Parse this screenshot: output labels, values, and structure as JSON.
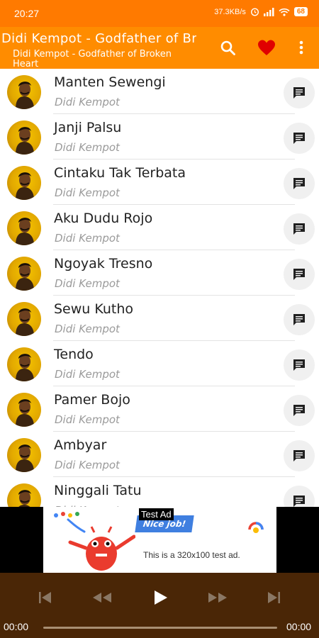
{
  "status_bar": {
    "time": "20:27",
    "network_speed": "37.3KB/s",
    "battery": "68"
  },
  "toolbar": {
    "title": "Didi Kempot - Godfather of Broken Heart",
    "subtitle": "Didi Kempot - Godfather of Broken Heart",
    "icons": [
      "search-icon",
      "heart-icon",
      "more-vert-icon"
    ],
    "accent_color": "#ff8c00"
  },
  "songs": [
    {
      "title": "Manten Sewengi",
      "artist": "Didi Kempot"
    },
    {
      "title": "Janji Palsu",
      "artist": "Didi Kempot"
    },
    {
      "title": "Cintaku Tak Terbata",
      "artist": "Didi Kempot"
    },
    {
      "title": "Aku Dudu Rojo",
      "artist": "Didi Kempot"
    },
    {
      "title": "Ngoyak Tresno",
      "artist": "Didi Kempot"
    },
    {
      "title": "Sewu Kutho",
      "artist": "Didi Kempot"
    },
    {
      "title": "Tendo",
      "artist": "Didi Kempot"
    },
    {
      "title": "Pamer Bojo",
      "artist": "Didi Kempot"
    },
    {
      "title": "Ambyar",
      "artist": "Didi Kempot"
    },
    {
      "title": "Ninggali Tatu",
      "artist": "Didi Kempot"
    }
  ],
  "ad": {
    "label": "Test Ad",
    "badge": "Nice job!",
    "text": "This is a 320x100 test ad."
  },
  "player": {
    "current_time": "00:00",
    "total_time": "00:00",
    "controls": [
      "skip-previous-icon",
      "rewind-icon",
      "play-icon",
      "fast-forward-icon",
      "skip-next-icon"
    ],
    "background_color": "#4a2606"
  }
}
